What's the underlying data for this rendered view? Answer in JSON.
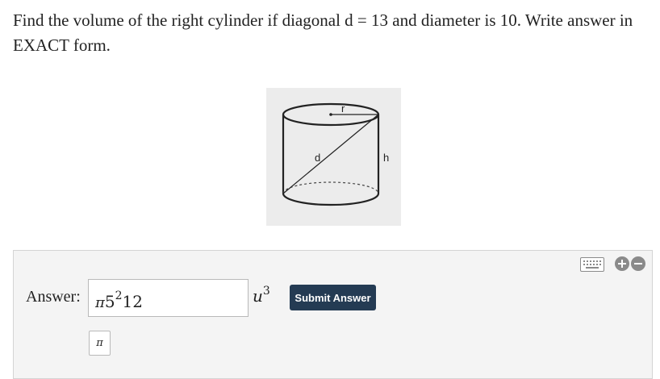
{
  "question": {
    "text": "Find the volume of the right cylinder if diagonal d = 13 and diameter is 10. Write answer in EXACT form."
  },
  "figure": {
    "labels": {
      "radius": "r",
      "diagonal": "d",
      "height": "h"
    }
  },
  "toolbar": {
    "icons": [
      "keyboard-icon",
      "plus-icon",
      "minus-icon"
    ]
  },
  "answer": {
    "label": "Answer:",
    "input": {
      "symbol": "π",
      "base": "5",
      "exponent": "2",
      "factor": "12"
    },
    "unit": {
      "symbol": "u",
      "exponent": "3"
    },
    "submit_label": "Submit Answer",
    "pi_button_label": "π"
  },
  "colors": {
    "submit_bg": "#243b53",
    "panel_bg": "#f4f4f4",
    "figure_bg": "#ececec"
  }
}
